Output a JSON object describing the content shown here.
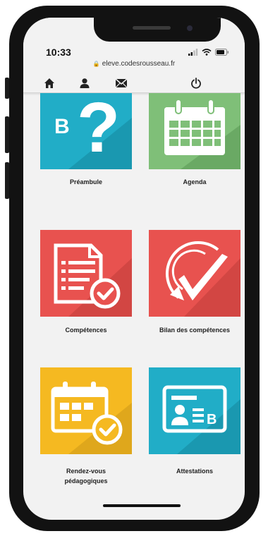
{
  "status": {
    "time": "10:33"
  },
  "browser": {
    "url": "eleve.codesrousseau.fr"
  },
  "toolbar": {
    "icons": [
      "home-icon",
      "user-icon",
      "mail-icon",
      "power-icon"
    ]
  },
  "tiles": [
    {
      "label": "Préambule",
      "icon": "question-b-icon",
      "color": "#21adc7"
    },
    {
      "label": "Agenda",
      "icon": "calendar-icon",
      "color": "#7fbf78"
    },
    {
      "label": "Compétences",
      "icon": "document-check-icon",
      "color": "#e8524f"
    },
    {
      "label": "Bilan des compétences",
      "icon": "checkmark-arrow-icon",
      "color": "#e8524f"
    },
    {
      "label": "Rendez-vous pédagogiques",
      "label_line1": "Rendez-vous",
      "label_line2": "pédagogiques",
      "icon": "calendar-check-icon",
      "color": "#f5b921"
    },
    {
      "label": "Attestations",
      "icon": "id-card-icon",
      "color": "#21adc7"
    }
  ]
}
